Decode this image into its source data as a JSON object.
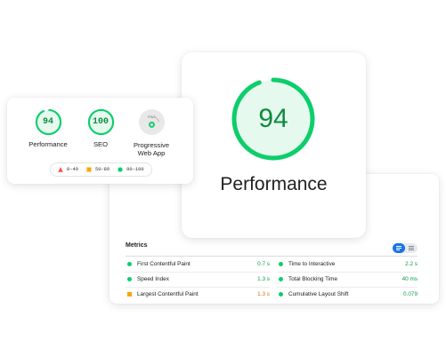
{
  "performance_card": {
    "score": "94",
    "label": "Performance"
  },
  "summary": {
    "categories": [
      {
        "score": "94",
        "label": "Performance"
      },
      {
        "score": "100",
        "label": "SEO"
      },
      {
        "badge": "PWA",
        "label_line1": "Progressive",
        "label_line2": "Web App"
      }
    ],
    "legend": [
      {
        "range": "0–49",
        "color": "#ff4e42",
        "shape": "triangle"
      },
      {
        "range": "50–89",
        "color": "#ffa400",
        "shape": "square"
      },
      {
        "range": "90–100",
        "color": "#0cce6b",
        "shape": "circle"
      }
    ]
  },
  "metrics": {
    "title": "Metrics",
    "items": [
      {
        "name": "First Contentful Paint",
        "value": "0.7 s",
        "status": "pass"
      },
      {
        "name": "Time to Interactive",
        "value": "2.2 s",
        "status": "pass"
      },
      {
        "name": "Speed Index",
        "value": "1.3 s",
        "status": "pass"
      },
      {
        "name": "Total Blocking Time",
        "value": "40 ms",
        "status": "pass"
      },
      {
        "name": "Largest Contentful Paint",
        "value": "1.3 s",
        "status": "average"
      },
      {
        "name": "Cumulative Layout Shift",
        "value": "0.079",
        "status": "pass"
      }
    ]
  },
  "colors": {
    "pass": "#0cce6b",
    "pass_text": "#0c8a3e",
    "average": "#ffa400",
    "fail": "#ff4e42",
    "toggle_active": "#1a73e8"
  },
  "icons": [
    "list-view-icon",
    "table-view-icon",
    "pwa-check-icon"
  ]
}
